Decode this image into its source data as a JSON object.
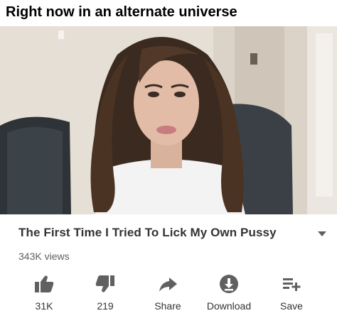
{
  "meme": {
    "caption": "Right now in an alternate universe"
  },
  "video": {
    "title": "The First Time I Tried To Lick My Own Pussy",
    "views": "343K views"
  },
  "actions": {
    "like_count": "31K",
    "dislike_count": "219",
    "share_label": "Share",
    "download_label": "Download",
    "save_label": "Save"
  },
  "icons": {
    "like": "thumbs-up-icon",
    "dislike": "thumbs-down-icon",
    "share": "share-arrow-icon",
    "download": "download-icon",
    "save": "playlist-add-icon",
    "expand": "caret-down-icon"
  },
  "colors": {
    "icon": "#606060",
    "title": "#333333",
    "meta": "#606060"
  }
}
